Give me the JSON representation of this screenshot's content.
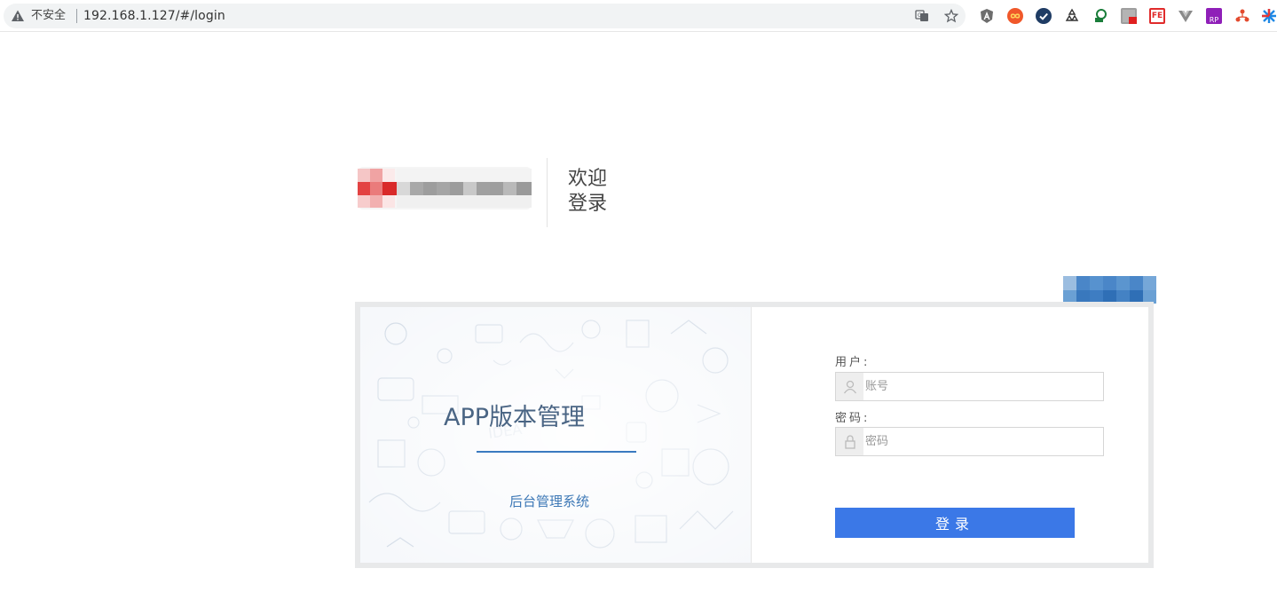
{
  "browser": {
    "security_label": "不安全",
    "url": "192.168.1.127/#/login",
    "icons": [
      "warning-icon",
      "translate-icon",
      "star-icon"
    ],
    "extensions": [
      "angular-ext-icon",
      "infinity-ext-icon",
      "check-ext-icon",
      "recycle-ext-icon",
      "leaf-ext-icon",
      "gray-ext-icon",
      "fe-ext-icon",
      "vue-ext-icon",
      "rp-ext-icon",
      "network-ext-icon",
      "star-ext-icon"
    ],
    "fe_badge": "FE",
    "rp_badge": "RP"
  },
  "header": {
    "welcome_line1": "欢迎",
    "welcome_line2": "登录"
  },
  "card": {
    "app_title": "APP版本管理",
    "subtitle": "后台管理系统"
  },
  "form": {
    "user_label": "用户:",
    "user_placeholder": "账号",
    "password_label": "密码:",
    "password_placeholder": "密码",
    "login_label": "登录"
  },
  "colors": {
    "primary_button": "#3b78e7",
    "title_color": "#4a6584",
    "subtitle_color": "#3d78b6"
  }
}
